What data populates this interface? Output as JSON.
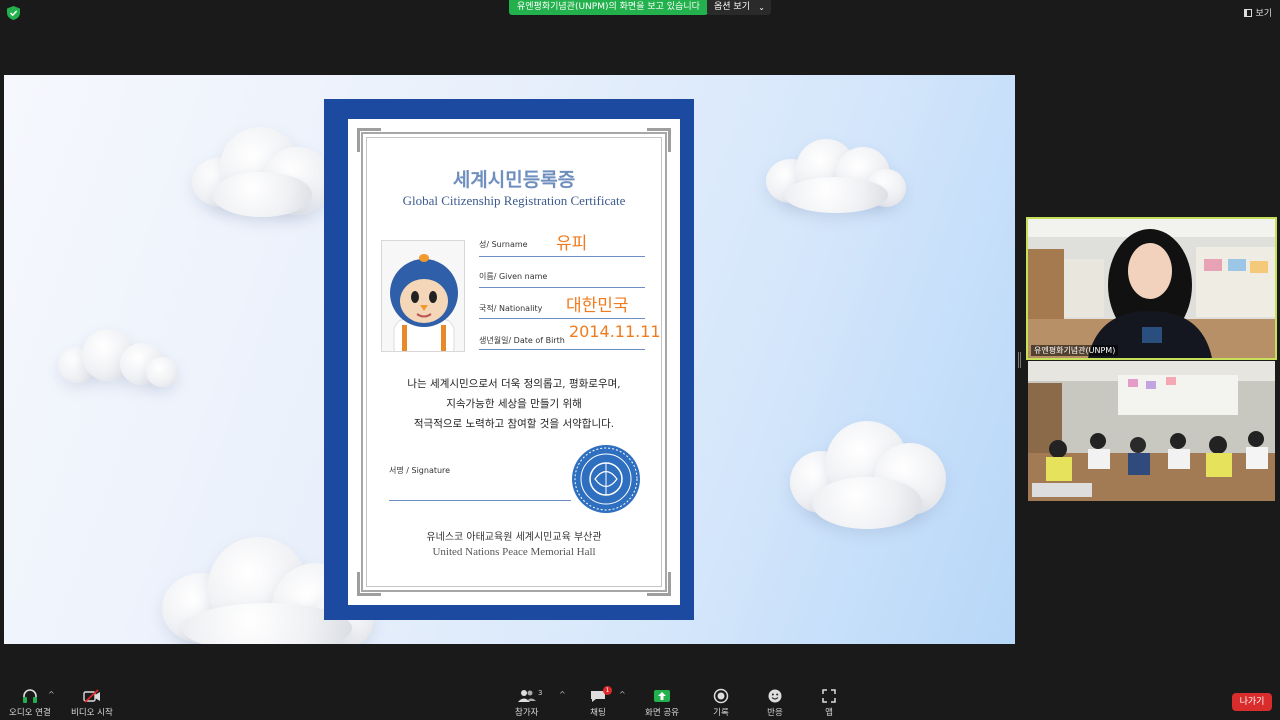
{
  "topbar": {
    "share_banner": "유엔평화기념관(UNPM)의 화면을 보고 있습니다",
    "view_options": "옵션 보기",
    "view_button": "보기"
  },
  "certificate": {
    "title_ko": "세계시민등록증",
    "title_en": "Global Citizenship Registration Certificate",
    "fields": [
      {
        "label": "성/ Surname",
        "value": "유피"
      },
      {
        "label": "이름/ Given name",
        "value": ""
      },
      {
        "label": "국적/ Nationality",
        "value": "대한민국"
      },
      {
        "label": "생년월일/ Date of Birth",
        "value": "2014.11.11"
      }
    ],
    "pledge": [
      "나는 세계시민으로서 더욱 정의롭고, 평화로우며,",
      "지속가능한 세상을 만들기 위해",
      "적극적으로 노력하고 참여할 것을 서약합니다."
    ],
    "signature_label": "서명 / Signature",
    "footer_ko": "유네스코 아태교육원 세계시민교육 부산관",
    "footer_en": "United Nations Peace Memorial Hall"
  },
  "videos": {
    "speaker_name": "유엔평화기념관(UNPM)"
  },
  "toolbar": {
    "audio": "오디오 연결",
    "video": "비디오 시작",
    "participants": "참가자",
    "participants_count": "3",
    "chat": "채팅",
    "chat_badge": "1",
    "share": "화면 공유",
    "record": "기록",
    "reactions": "반응",
    "apps": "앱",
    "leave": "나가기"
  },
  "colors": {
    "accent_green": "#22b14c",
    "leave_red": "#d92d2d",
    "cert_blue": "#1c4aa1",
    "value_orange": "#f07b1e",
    "speaker_border": "#c6e05a"
  }
}
